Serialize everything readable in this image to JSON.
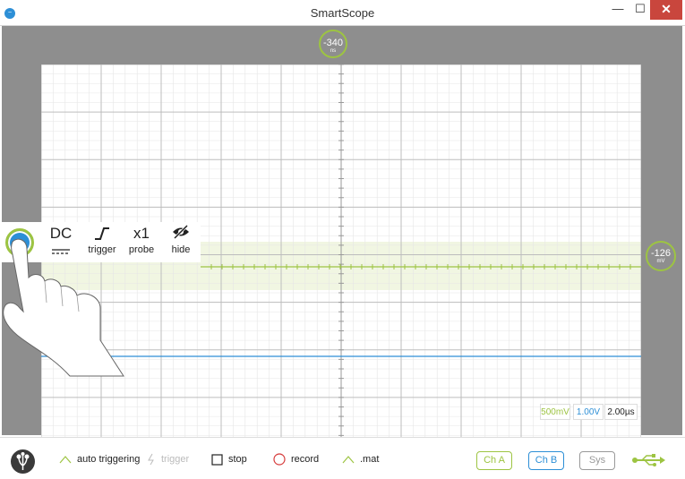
{
  "window": {
    "title": "SmartScope",
    "minimize": "—",
    "maximize": "☐",
    "close": "✕"
  },
  "app_icon": "scope-logo-icon",
  "markers": {
    "time": {
      "value": "-340",
      "unit": "ns"
    },
    "level": {
      "value": "-126",
      "unit": "mV"
    }
  },
  "channel_menu": {
    "coupling": "DC",
    "trigger": "trigger",
    "probe_value": "x1",
    "probe": "probe",
    "hide": "hide"
  },
  "scales": {
    "ch_a": "500mV",
    "ch_b": "1.00V",
    "time": "2.00µs"
  },
  "toolbar": {
    "auto_triggering": "auto triggering",
    "trigger": "trigger",
    "stop": "stop",
    "record": "record",
    "mat": ".mat",
    "ch_a": "Ch A",
    "ch_b": "Ch B",
    "sys": "Sys"
  },
  "colors": {
    "channel_a": "#9dc442",
    "channel_b": "#2d8fd6",
    "close": "#c9463d",
    "background": "#8e8e8e"
  }
}
